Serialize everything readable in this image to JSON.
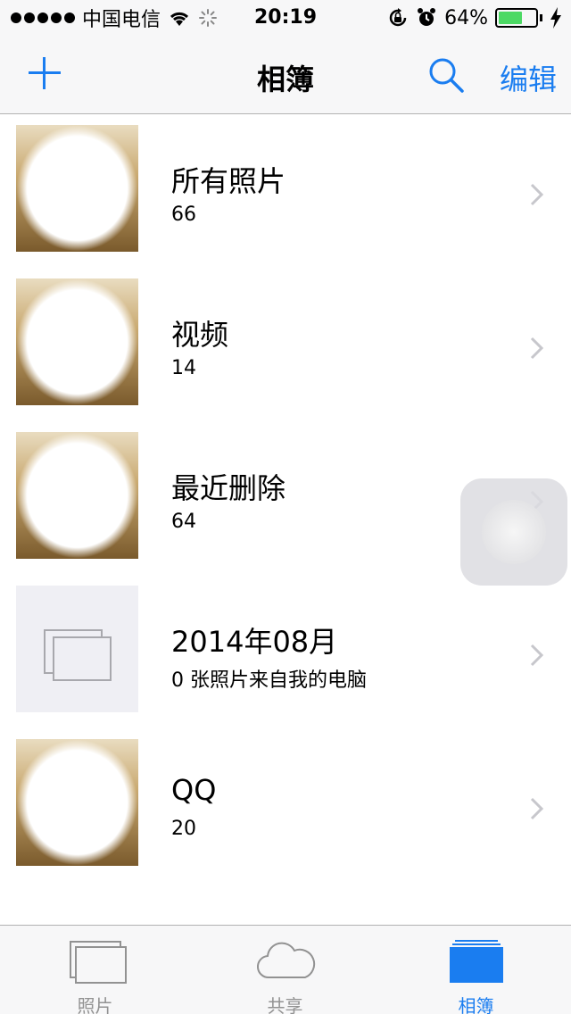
{
  "status_bar": {
    "carrier": "中国电信",
    "time": "20:19",
    "battery_percent": "64%",
    "battery_level": 0.64
  },
  "nav_bar": {
    "title": "相簿",
    "edit_label": "编辑"
  },
  "albums": [
    {
      "title": "所有照片",
      "count": "66"
    },
    {
      "title": "视频",
      "count": "14"
    },
    {
      "title": "最近删除",
      "count": "64"
    },
    {
      "title": "2014年08月",
      "count": "0 张照片来自我的电脑"
    },
    {
      "title": "QQ",
      "count": "20"
    }
  ],
  "tab_bar": {
    "tabs": [
      {
        "label": "照片",
        "icon": "photos-icon"
      },
      {
        "label": "共享",
        "icon": "cloud-icon"
      },
      {
        "label": "相簿",
        "icon": "albums-icon"
      }
    ],
    "active_index": 2
  },
  "colors": {
    "accent": "#1a7df0",
    "battery": "#4cd964",
    "tab_inactive": "#929292"
  }
}
